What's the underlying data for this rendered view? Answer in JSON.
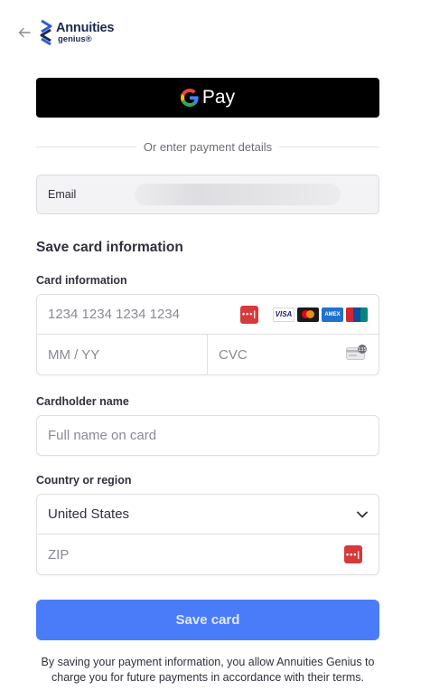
{
  "header": {
    "back_icon": "arrow-left-icon",
    "logo_title": "Annuities",
    "logo_sub": "genius®"
  },
  "gpay": {
    "label": "Pay",
    "icon": "google-g-icon"
  },
  "divider": {
    "text": "Or enter payment details"
  },
  "email": {
    "label": "Email"
  },
  "section_title": "Save card information",
  "card": {
    "label": "Card information",
    "number_placeholder": "1234 1234 1234 1234",
    "expiry_placeholder": "MM / YY",
    "cvc_placeholder": "CVC",
    "brands": [
      "VISA",
      "mastercard",
      "AMEX",
      "UnionPay"
    ]
  },
  "cardholder": {
    "label": "Cardholder name",
    "placeholder": "Full name on card"
  },
  "country": {
    "label": "Country or region",
    "value": "United States",
    "zip_placeholder": "ZIP"
  },
  "save_button": "Save card",
  "terms": "By saving your payment information, you allow Annuities Genius to charge you for future payments in accordance with their terms.",
  "colors": {
    "button": "#4a7cfa",
    "gpay": "#000000",
    "password_manager": "#d63a3a"
  }
}
